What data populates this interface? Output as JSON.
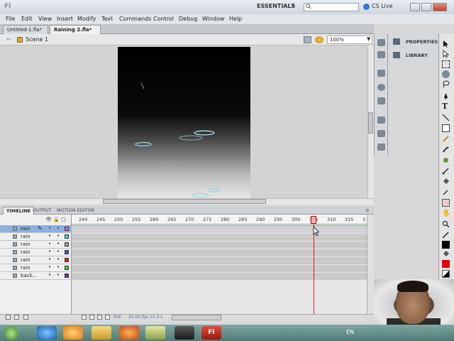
{
  "app": {
    "logo": "Fl",
    "workspace": "ESSENTIALS",
    "cs_live": "CS Live",
    "search_placeholder": ""
  },
  "menu": [
    "File",
    "Edit",
    "View",
    "Insert",
    "Modify",
    "Text",
    "Commands",
    "Control",
    "Debug",
    "Window",
    "Help"
  ],
  "doc_tabs": [
    {
      "label": "Untitled-1.fla*",
      "close": "×"
    },
    {
      "label": "Raining 2.fla*",
      "close": "×"
    }
  ],
  "edit_bar": {
    "scene": "Scene 1",
    "zoom": "100%"
  },
  "panel_tabs": [
    "TIMELINE",
    "OUTPUT",
    "MOTION EDITOR"
  ],
  "ruler_labels": [
    "240",
    "245",
    "250",
    "255",
    "260",
    "265",
    "270",
    "275",
    "280",
    "285",
    "290",
    "295",
    "300",
    "305",
    "310",
    "315",
    "3"
  ],
  "layers": [
    {
      "name": "rain",
      "color": "#c86ee0",
      "selected": true
    },
    {
      "name": "rain",
      "color": "#3ed2e0",
      "selected": false
    },
    {
      "name": "rain",
      "color": "#9a9a9a",
      "selected": false
    },
    {
      "name": "rain",
      "color": "#3a57d8",
      "selected": false
    },
    {
      "name": "rain",
      "color": "#e02020",
      "selected": false
    },
    {
      "name": "rain",
      "color": "#39d039",
      "selected": false
    },
    {
      "name": "back...",
      "color": "#7c2fb0",
      "selected": false
    }
  ],
  "timeline_status": {
    "frame": "306",
    "fps": "20.00 fps",
    "time": "15.3 s"
  },
  "right_panel": {
    "properties": "PROPERTIES",
    "library": "LIBRARY"
  },
  "taskbar": {
    "lang": "EN"
  }
}
